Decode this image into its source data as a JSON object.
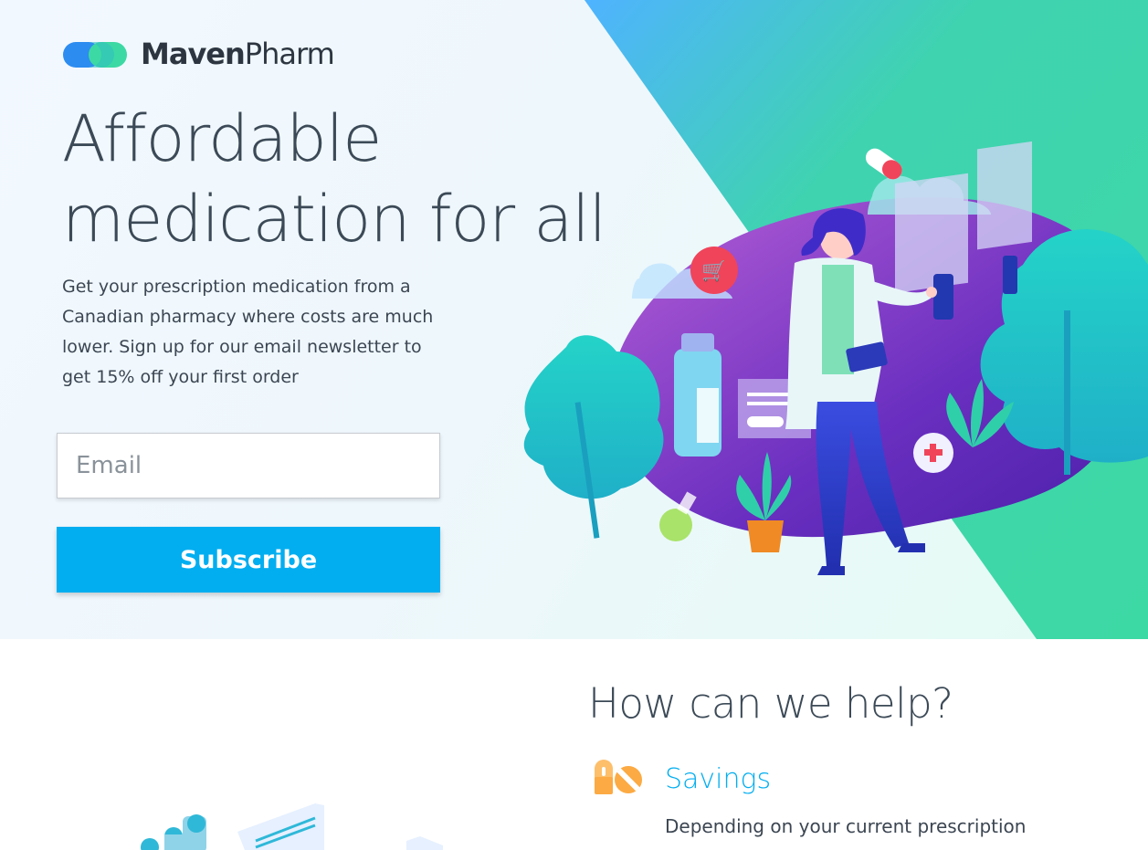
{
  "brand": {
    "name_bold": "Maven",
    "name_light": "Pharm"
  },
  "hero": {
    "title_line1": "Affordable",
    "title_line2": "medication for all",
    "copy": "Get your prescription medication from a Canadian pharmacy where costs are much lower. Sign up for our email newsletter to get 15% off your first order",
    "email_placeholder": "Email",
    "subscribe_label": "Subscribe"
  },
  "help": {
    "title": "How can we help?",
    "features": [
      {
        "icon": "pills-icon",
        "title": "Savings",
        "description": "Depending on your current prescription"
      }
    ]
  },
  "colors": {
    "accent": "#03aef0",
    "green": "#3dd9a4",
    "purple": "#7a3fc4",
    "text": "#3c4a57"
  }
}
